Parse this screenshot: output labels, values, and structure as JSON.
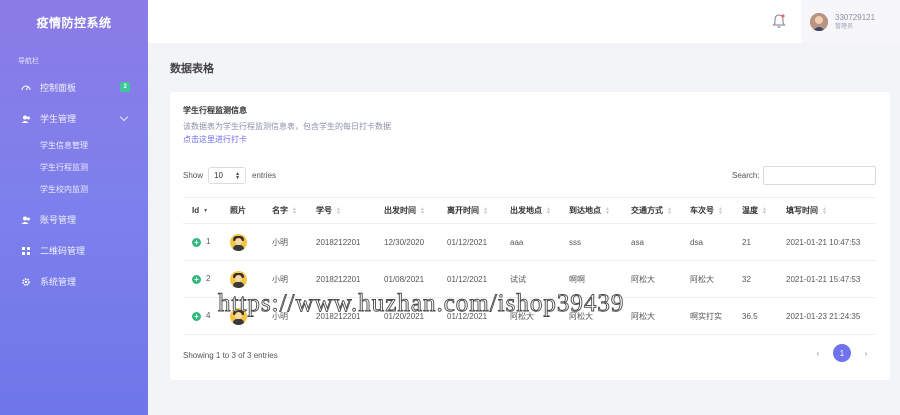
{
  "app": {
    "title": "疫情防控系统",
    "nav_caption": "导航栏"
  },
  "sidebar": {
    "items": [
      {
        "label": "控制面板",
        "icon": "gauge-icon",
        "badge": "3"
      },
      {
        "label": "学生管理",
        "icon": "users-icon"
      },
      {
        "label": "账号管理",
        "icon": "users-icon"
      },
      {
        "label": "二维码管理",
        "icon": "grid-icon"
      },
      {
        "label": "系统管理",
        "icon": "gear-icon"
      }
    ],
    "sub_items": [
      {
        "label": "学生信息管理"
      },
      {
        "label": "学生行程监测"
      },
      {
        "label": "学生校内监测"
      }
    ]
  },
  "topbar": {
    "username": "330729121",
    "role": "管理员"
  },
  "page": {
    "title": "数据表格"
  },
  "card": {
    "title": "学生行程监测信息",
    "description": "该数据表为学生行程监测信息表，包含学生的每日打卡数据",
    "link": "点击这里进行打卡"
  },
  "table_controls": {
    "show": "Show",
    "length": "10",
    "entries": "entries",
    "search_label": "Search:"
  },
  "table": {
    "headers": [
      "Id",
      "照片",
      "名字",
      "学号",
      "出发时间",
      "离开时间",
      "出发地点",
      "到达地点",
      "交通方式",
      "车次号",
      "温度",
      "填写时间"
    ],
    "rows": [
      [
        "1",
        "",
        "小明",
        "2018212201",
        "12/30/2020",
        "01/12/2021",
        "aaa",
        "sss",
        "asa",
        "dsa",
        "21",
        "2021-01-21 10:47:53"
      ],
      [
        "2",
        "",
        "小明",
        "2018212201",
        "01/08/2021",
        "01/12/2021",
        "试试",
        "啊啊",
        "阿松大",
        "阿松大",
        "32",
        "2021-01-21 15:47:53"
      ],
      [
        "4",
        "",
        "小明",
        "2018212201",
        "01/20/2021",
        "01/12/2021",
        "阿松大",
        "阿松大",
        "阿松大",
        "啊实打实",
        "36.5",
        "2021-01-23 21:24:35"
      ]
    ]
  },
  "footer": {
    "info": "Showing 1 to 3 of 3 entries",
    "prev": "‹",
    "page": "1",
    "next": "›"
  },
  "watermark": "https://www.huzhan.com/ishop39439",
  "colors": {
    "sidebar_top": "#8b7be6",
    "sidebar_bottom": "#6f76e8",
    "accent": "#6f74ec",
    "badge": "#3cc796",
    "plus": "#31b97b"
  }
}
